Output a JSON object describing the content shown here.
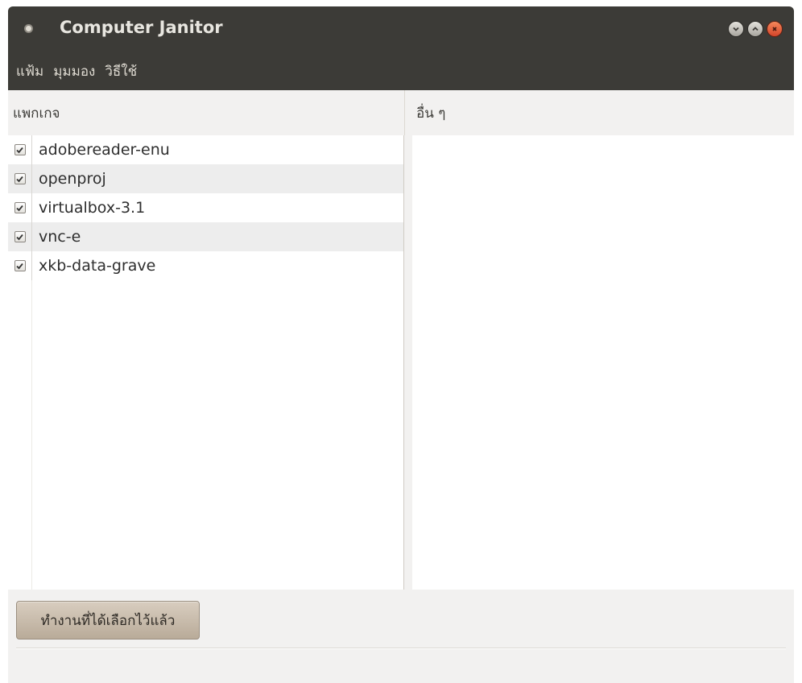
{
  "window": {
    "title": "Computer Janitor"
  },
  "menubar": {
    "items": [
      {
        "label": "แฟ้ม"
      },
      {
        "label": "มุมมอง"
      },
      {
        "label": "วิธีใช้"
      }
    ]
  },
  "packages_pane": {
    "header": "แพกเกจ",
    "items": [
      {
        "name": "adobereader-enu",
        "checked": true
      },
      {
        "name": "openproj",
        "checked": true
      },
      {
        "name": "virtualbox-3.1",
        "checked": true
      },
      {
        "name": "vnc-e",
        "checked": true
      },
      {
        "name": "xkb-data-grave",
        "checked": true
      }
    ]
  },
  "other_pane": {
    "header": "อื่น ๆ"
  },
  "actions": {
    "do_selected_label": "ทำงานที่ได้เลือกไว้แล้ว"
  },
  "colors": {
    "titlebar": "#3c3b37",
    "window_bg": "#f2f1f0",
    "close_button": "#e05a32"
  }
}
